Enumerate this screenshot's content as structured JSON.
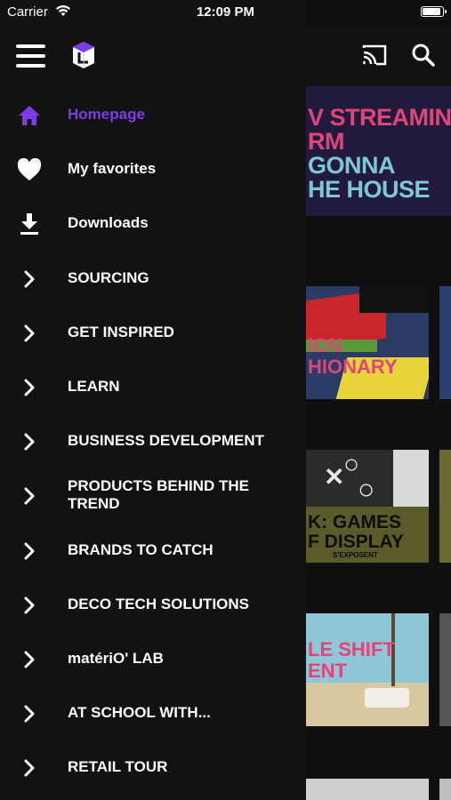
{
  "status": {
    "carrier": "Carrier",
    "time": "12:09 PM",
    "battery_level": 1.0
  },
  "drawer": {
    "items": [
      {
        "label": "Homepage",
        "icon": "home-icon",
        "active": true
      },
      {
        "label": "My favorites",
        "icon": "heart-icon"
      },
      {
        "label": "Downloads",
        "icon": "download-icon"
      },
      {
        "label": "SOURCING",
        "icon": "chevron-right-icon"
      },
      {
        "label": "GET INSPIRED",
        "icon": "chevron-right-icon"
      },
      {
        "label": "LEARN",
        "icon": "chevron-right-icon"
      },
      {
        "label": "BUSINESS DEVELOPMENT",
        "icon": "chevron-right-icon"
      },
      {
        "label": "PRODUCTS BEHIND THE TREND",
        "icon": "chevron-right-icon"
      },
      {
        "label": "BRANDS TO CATCH",
        "icon": "chevron-right-icon"
      },
      {
        "label": "DECO TECH SOLUTIONS",
        "icon": "chevron-right-icon"
      },
      {
        "label": "matériO' LAB",
        "icon": "chevron-right-icon"
      },
      {
        "label": "AT SCHOOL WITH...",
        "icon": "chevron-right-icon"
      },
      {
        "label": "RETAIL TOUR",
        "icon": "chevron-right-icon"
      }
    ]
  },
  "background": {
    "hero_lines": [
      "V STREAMING",
      "RM",
      "GONNA",
      "HE HOUSE"
    ],
    "card1_lines": [
      "ION",
      "HIONARY"
    ],
    "card2_lines": [
      "K: GAMES",
      "F DISPLAY",
      "S'EXPOSENT"
    ],
    "card3_lines": [
      "LE SHIFT",
      "ENT"
    ]
  },
  "colors": {
    "accent": "#7d3ce8",
    "drawer_bg": "#121212",
    "hero_text": "#e0457a",
    "hero_text_alt": "#7ec7d6"
  }
}
